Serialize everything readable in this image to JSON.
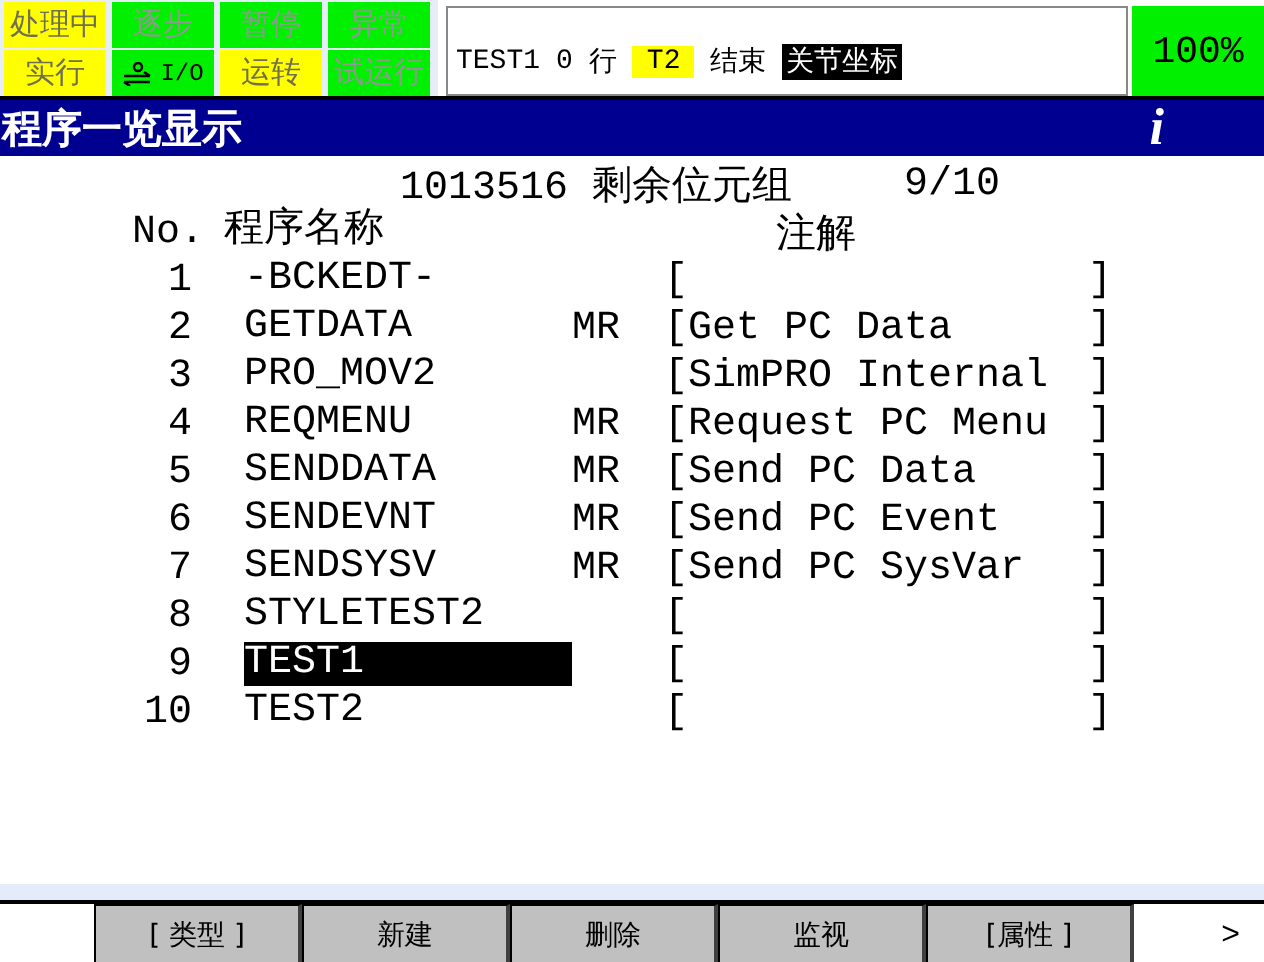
{
  "indicators": [
    {
      "label": "处理中",
      "on": true
    },
    {
      "label": "逐步",
      "on": false
    },
    {
      "label": "暂停",
      "on": false
    },
    {
      "label": "异常",
      "on": false
    },
    {
      "label": "实行",
      "on": true
    },
    {
      "label": "I/O",
      "on": false,
      "kind": "io"
    },
    {
      "label": "运转",
      "on": true
    },
    {
      "label": "试运行",
      "on": false
    }
  ],
  "status": {
    "program": "TEST1",
    "line": "0",
    "line_unit": "行",
    "mode": "T2",
    "state": "结束",
    "coord": "关节坐标"
  },
  "override": "100%",
  "title": "程序一览显示",
  "info": "i",
  "summary": {
    "memory": "1013516 剩余位元组",
    "count": "9/10"
  },
  "columns": [
    "No.",
    "程序名称",
    "注解"
  ],
  "rows": [
    {
      "no": "1",
      "name": "-BCKEDT-",
      "attr": "",
      "open": "[",
      "comment": "",
      "close": "]",
      "selected": false
    },
    {
      "no": "2",
      "name": "GETDATA",
      "attr": "MR",
      "open": "[",
      "comment": "Get PC Data",
      "close": "]",
      "selected": false
    },
    {
      "no": "3",
      "name": "PRO_MOV2",
      "attr": "",
      "open": "[",
      "comment": "SimPRO Internal",
      "close": "]",
      "selected": false
    },
    {
      "no": "4",
      "name": "REQMENU",
      "attr": "MR",
      "open": "[",
      "comment": "Request PC Menu",
      "close": "]",
      "selected": false
    },
    {
      "no": "5",
      "name": "SENDDATA",
      "attr": "MR",
      "open": "[",
      "comment": "Send PC Data",
      "close": "]",
      "selected": false
    },
    {
      "no": "6",
      "name": "SENDEVNT",
      "attr": "MR",
      "open": "[",
      "comment": "Send PC Event",
      "close": "]",
      "selected": false
    },
    {
      "no": "7",
      "name": "SENDSYSV",
      "attr": "MR",
      "open": "[",
      "comment": "Send PC SysVar",
      "close": "]",
      "selected": false
    },
    {
      "no": "8",
      "name": "STYLETEST2",
      "attr": "",
      "open": "[",
      "comment": "",
      "close": "]",
      "selected": false
    },
    {
      "no": "9",
      "name": "TEST1",
      "attr": "",
      "open": "[",
      "comment": "",
      "close": "]",
      "selected": true
    },
    {
      "no": "10",
      "name": "TEST2",
      "attr": "",
      "open": "[",
      "comment": "",
      "close": "]",
      "selected": false
    }
  ],
  "softkeys": [
    "[ 类型 ]",
    "新建",
    "删除",
    "监视",
    "[属性 ]"
  ],
  "next": ">"
}
